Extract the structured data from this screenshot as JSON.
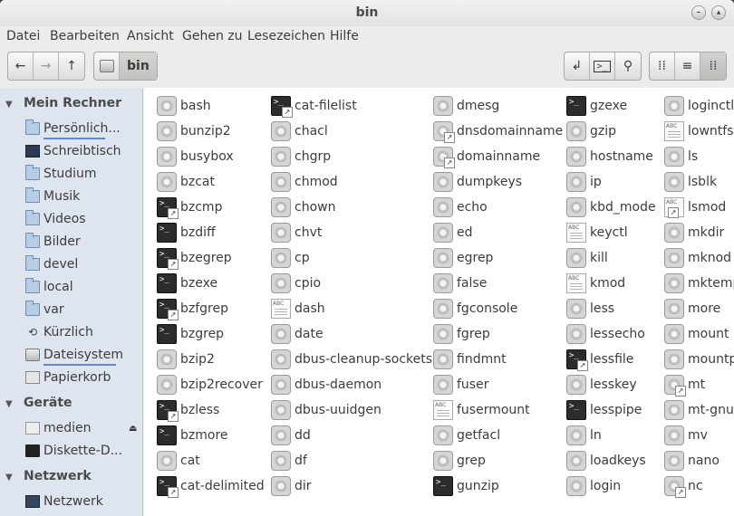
{
  "window": {
    "title": "bin"
  },
  "menu": [
    {
      "label": "Datei"
    },
    {
      "label": "Bearbeiten"
    },
    {
      "label": "Ansicht"
    },
    {
      "label": "Gehen zu"
    },
    {
      "label": "Lesezeichen"
    },
    {
      "label": "Hilfe"
    }
  ],
  "toolbar": {
    "back_icon": "←",
    "forward_icon": "→",
    "up_icon": "↑",
    "path_current": "bin",
    "location_icon": "↲",
    "terminal_icon": ">_",
    "search_icon": "⚲",
    "icon_view": "⁞⁞",
    "list_view": "≡",
    "compact_view": "⁞⁞"
  },
  "sidebar": {
    "computer": {
      "header": "Mein Rechner",
      "items": [
        {
          "label": "Persönlich..."
        },
        {
          "label": "Schreibtisch"
        },
        {
          "label": "Studium"
        },
        {
          "label": "Musik"
        },
        {
          "label": "Videos"
        },
        {
          "label": "Bilder"
        },
        {
          "label": "devel"
        },
        {
          "label": "local"
        },
        {
          "label": "var"
        },
        {
          "label": "Kürzlich"
        },
        {
          "label": "Dateisystem"
        },
        {
          "label": "Papierkorb"
        }
      ]
    },
    "devices": {
      "header": "Geräte",
      "items": [
        {
          "label": "medien"
        },
        {
          "label": "Diskette-D..."
        }
      ]
    },
    "network": {
      "header": "Netzwerk",
      "items": [
        {
          "label": "Netzwerk"
        }
      ]
    }
  },
  "files": {
    "col1": [
      {
        "name": "bash",
        "type": "exec"
      },
      {
        "name": "bunzip2",
        "type": "exec"
      },
      {
        "name": "busybox",
        "type": "exec"
      },
      {
        "name": "bzcat",
        "type": "exec"
      },
      {
        "name": "bzcmp",
        "type": "term-link"
      },
      {
        "name": "bzdiff",
        "type": "term"
      },
      {
        "name": "bzegrep",
        "type": "term-link"
      },
      {
        "name": "bzexe",
        "type": "term"
      },
      {
        "name": "bzfgrep",
        "type": "term-link"
      },
      {
        "name": "bzgrep",
        "type": "term"
      },
      {
        "name": "bzip2",
        "type": "exec"
      },
      {
        "name": "bzip2recover",
        "type": "exec"
      },
      {
        "name": "bzless",
        "type": "term-link"
      },
      {
        "name": "bzmore",
        "type": "term"
      },
      {
        "name": "cat",
        "type": "exec"
      },
      {
        "name": "cat-delimited",
        "type": "term-link"
      }
    ],
    "col2": [
      {
        "name": "cat-filelist",
        "type": "term-link"
      },
      {
        "name": "chacl",
        "type": "exec"
      },
      {
        "name": "chgrp",
        "type": "exec"
      },
      {
        "name": "chmod",
        "type": "exec"
      },
      {
        "name": "chown",
        "type": "exec"
      },
      {
        "name": "chvt",
        "type": "exec"
      },
      {
        "name": "cp",
        "type": "exec"
      },
      {
        "name": "cpio",
        "type": "exec"
      },
      {
        "name": "dash",
        "type": "text"
      },
      {
        "name": "date",
        "type": "exec"
      },
      {
        "name": "dbus-cleanup-sockets",
        "type": "exec"
      },
      {
        "name": "dbus-daemon",
        "type": "exec"
      },
      {
        "name": "dbus-uuidgen",
        "type": "exec"
      },
      {
        "name": "dd",
        "type": "exec"
      },
      {
        "name": "df",
        "type": "exec"
      },
      {
        "name": "dir",
        "type": "exec"
      }
    ],
    "col3": [
      {
        "name": "dmesg",
        "type": "exec"
      },
      {
        "name": "dnsdomainname",
        "type": "exec-link"
      },
      {
        "name": "domainname",
        "type": "exec-link"
      },
      {
        "name": "dumpkeys",
        "type": "exec"
      },
      {
        "name": "echo",
        "type": "exec"
      },
      {
        "name": "ed",
        "type": "exec"
      },
      {
        "name": "egrep",
        "type": "exec"
      },
      {
        "name": "false",
        "type": "exec"
      },
      {
        "name": "fgconsole",
        "type": "exec"
      },
      {
        "name": "fgrep",
        "type": "exec"
      },
      {
        "name": "findmnt",
        "type": "exec"
      },
      {
        "name": "fuser",
        "type": "exec"
      },
      {
        "name": "fusermount",
        "type": "text"
      },
      {
        "name": "getfacl",
        "type": "exec"
      },
      {
        "name": "grep",
        "type": "exec"
      },
      {
        "name": "gunzip",
        "type": "term"
      }
    ],
    "col4": [
      {
        "name": "gzexe",
        "type": "term"
      },
      {
        "name": "gzip",
        "type": "exec"
      },
      {
        "name": "hostname",
        "type": "exec"
      },
      {
        "name": "ip",
        "type": "exec"
      },
      {
        "name": "kbd_mode",
        "type": "exec"
      },
      {
        "name": "keyctl",
        "type": "text"
      },
      {
        "name": "kill",
        "type": "exec"
      },
      {
        "name": "kmod",
        "type": "text"
      },
      {
        "name": "less",
        "type": "exec"
      },
      {
        "name": "lessecho",
        "type": "exec"
      },
      {
        "name": "lessfile",
        "type": "term-link"
      },
      {
        "name": "lesskey",
        "type": "exec"
      },
      {
        "name": "lesspipe",
        "type": "term"
      },
      {
        "name": "ln",
        "type": "exec"
      },
      {
        "name": "loadkeys",
        "type": "exec"
      },
      {
        "name": "login",
        "type": "exec"
      }
    ],
    "col5": [
      {
        "name": "loginctl",
        "type": "exec"
      },
      {
        "name": "lowntfs",
        "type": "text"
      },
      {
        "name": "ls",
        "type": "exec"
      },
      {
        "name": "lsblk",
        "type": "exec"
      },
      {
        "name": "lsmod",
        "type": "text-link"
      },
      {
        "name": "mkdir",
        "type": "exec"
      },
      {
        "name": "mknod",
        "type": "exec"
      },
      {
        "name": "mktemp",
        "type": "exec"
      },
      {
        "name": "more",
        "type": "exec"
      },
      {
        "name": "mount",
        "type": "exec"
      },
      {
        "name": "mountp",
        "type": "exec"
      },
      {
        "name": "mt",
        "type": "exec-link"
      },
      {
        "name": "mt-gnu",
        "type": "exec"
      },
      {
        "name": "mv",
        "type": "exec"
      },
      {
        "name": "nano",
        "type": "exec"
      },
      {
        "name": "nc",
        "type": "exec-link"
      }
    ]
  }
}
